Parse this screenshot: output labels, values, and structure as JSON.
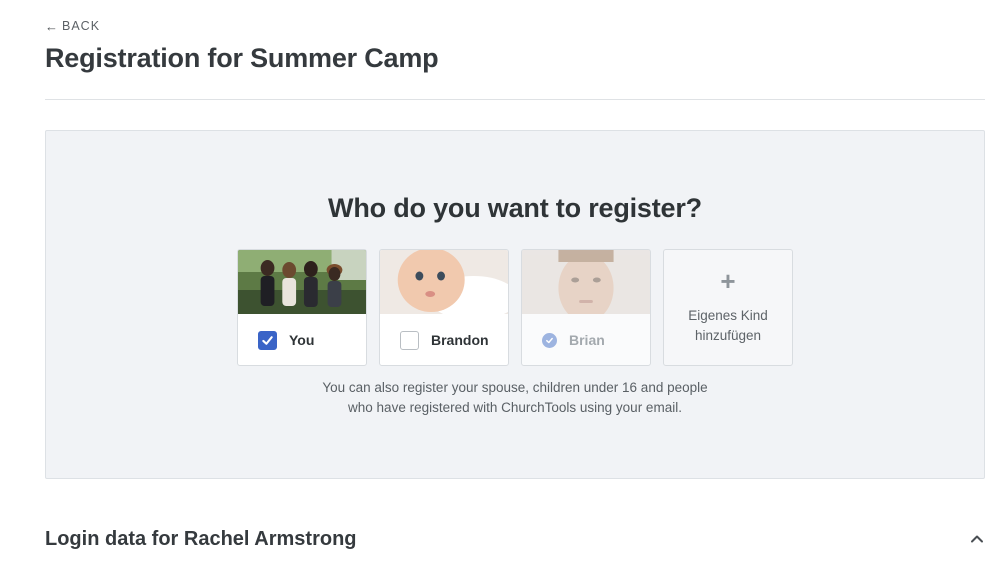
{
  "header": {
    "back_label": "BACK",
    "title": "Registration for Summer Camp"
  },
  "register_panel": {
    "question": "Who do you want to register?",
    "people": [
      {
        "name": "You",
        "state": "checked"
      },
      {
        "name": "Brandon",
        "state": "unchecked"
      },
      {
        "name": "Brian",
        "state": "disabled-registered"
      }
    ],
    "add_child_label": "Eigenes Kind hinzufügen",
    "note_line1": "You can also register your spouse, children under 16 and people",
    "note_line2": "who have registered with ChurchTools using your email."
  },
  "login_section": {
    "title": "Login data for Rachel Armstrong",
    "expanded": true
  },
  "colors": {
    "accent": "#3a64c7",
    "panel_bg": "#f1f3f6",
    "text": "#2f3437"
  }
}
